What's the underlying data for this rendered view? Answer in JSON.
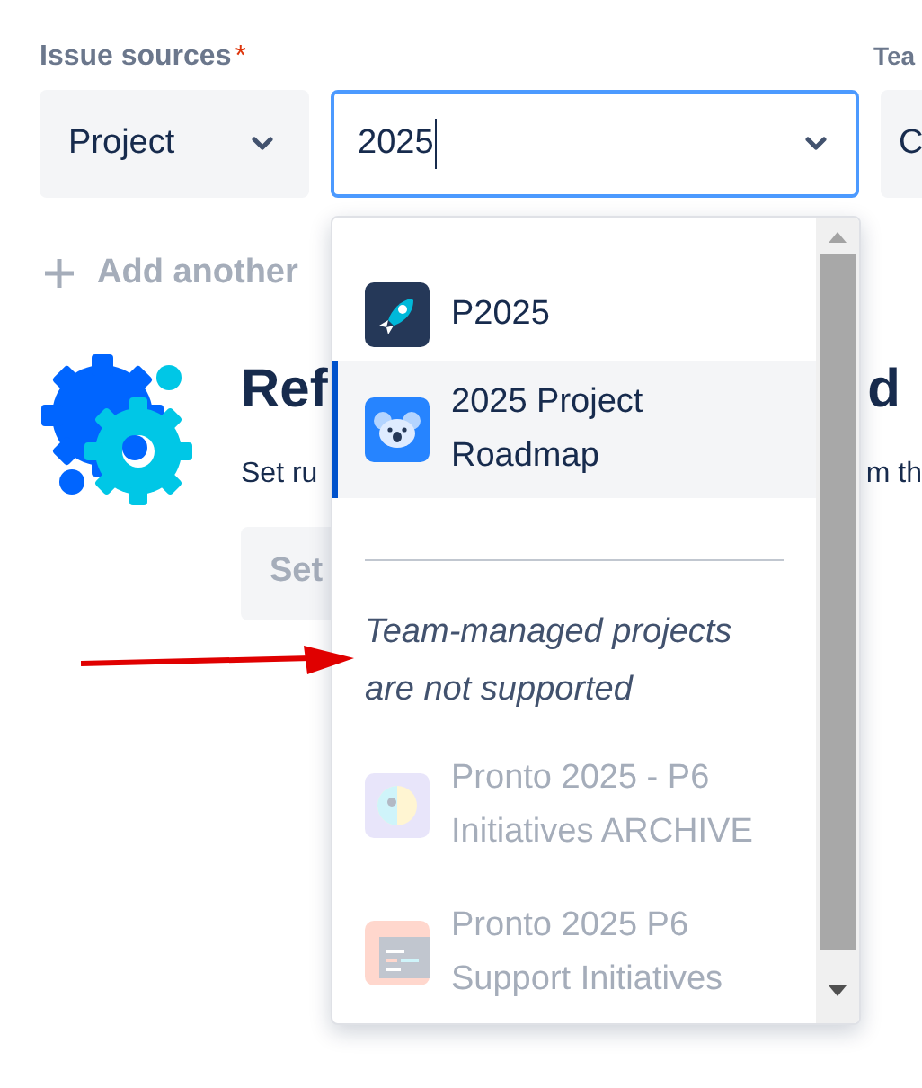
{
  "issue_sources": {
    "label": "Issue sources",
    "required_mark": "*",
    "type_select": {
      "value": "Project"
    },
    "search_field": {
      "value": "2025"
    }
  },
  "next_column": {
    "label": "Tea",
    "select_value": "C"
  },
  "add_another": {
    "label": "Add another"
  },
  "empty_state": {
    "heading_start": "Ref",
    "heading_end": "d",
    "text_start": "Set ru",
    "text_end": "m th",
    "button": "Set"
  },
  "dropdown": {
    "options": [
      {
        "label": "P2025",
        "kind": "rocket",
        "selected": false,
        "disabled": false
      },
      {
        "label": "2025 Project Roadmap",
        "kind": "koala",
        "selected": true,
        "disabled": false
      }
    ],
    "note": "Team-managed projects are not supported",
    "unsupported_options": [
      {
        "label": "Pronto 2025 - P6 Initiatives ARCHIVE",
        "kind": "bird",
        "selected": false,
        "disabled": true
      },
      {
        "label": "Pronto 2025 P6 Support Initiatives",
        "kind": "window",
        "selected": false,
        "disabled": true
      }
    ]
  }
}
